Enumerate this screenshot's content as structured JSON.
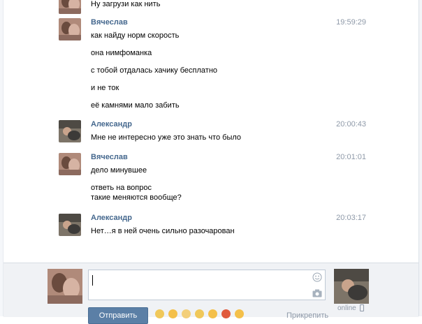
{
  "top_message": {
    "text": "Ну загрузи как нить"
  },
  "messages": [
    {
      "author": "Вячеслав",
      "time": "19:59:29",
      "lines": [
        "как найду норм скорость",
        "она нимфоманка",
        "с тобой отдалась хачику бесплатно",
        "и не ток",
        "её камнями мало забить"
      ]
    },
    {
      "author": "Александр",
      "time": "20:00:43",
      "lines": [
        "Мне не интересно уже это знать что было"
      ]
    },
    {
      "author": "Вячеслав",
      "time": "20:01:01",
      "lines": [
        "дело минувшее",
        "ответь на вопрос",
        "такие меняются вообще?"
      ]
    },
    {
      "author": "Александр",
      "time": "20:03:17",
      "lines": [
        "Нет…я в ней очень сильно разочарован"
      ]
    }
  ],
  "composer": {
    "input_value": "",
    "send_label": "Отправить",
    "attach_label": "Прикрепить",
    "status": "online"
  },
  "icons": {
    "smile": "smile-icon",
    "camera": "camera-icon",
    "phone": "mobile-phone-icon"
  },
  "colors": {
    "author": "#45688e",
    "time": "#8e99a8",
    "send_button": "#5b7fa6"
  }
}
